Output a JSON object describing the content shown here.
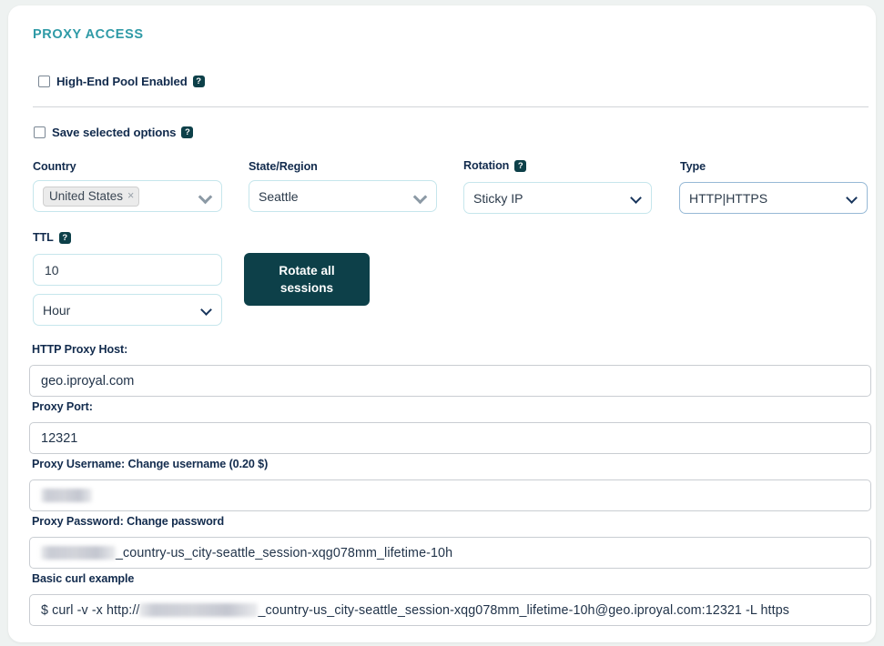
{
  "section": {
    "title": "PROXY ACCESS"
  },
  "toggles": {
    "high_end_pool": {
      "label": "High-End Pool Enabled",
      "checked": false,
      "help": "?"
    },
    "save_options": {
      "label": "Save selected options",
      "checked": false,
      "help": "?"
    }
  },
  "filters": {
    "country": {
      "label": "Country",
      "chip_value": "United States",
      "chip_remove": "×"
    },
    "state_region": {
      "label": "State/Region",
      "value": "Seattle"
    },
    "rotation": {
      "label": "Rotation",
      "help": "?",
      "value": "Sticky IP"
    },
    "type": {
      "label": "Type",
      "value": "HTTP|HTTPS"
    },
    "ttl": {
      "label": "TTL",
      "help": "?",
      "value": "10",
      "unit": "Hour"
    }
  },
  "actions": {
    "rotate_all_sessions": "Rotate all sessions"
  },
  "credentials": {
    "http_proxy_host": {
      "label": "HTTP Proxy Host:",
      "value": "geo.iproyal.com"
    },
    "proxy_port": {
      "label": "Proxy Port:",
      "value": "12321"
    },
    "proxy_username": {
      "label": "Proxy Username: Change username (0.20 $)",
      "value_masked": true,
      "value_suffix": ""
    },
    "proxy_password": {
      "label": "Proxy Password: Change password",
      "value_masked": true,
      "value_suffix": "_country-us_city-seattle_session-xqg078mm_lifetime-10h"
    },
    "curl_example": {
      "label": "Basic curl example",
      "prefix": "$ curl -v -x http://",
      "value_masked": true,
      "value_suffix": "_country-us_city-seattle_session-xqg078mm_lifetime-10h@geo.iproyal.com:12321 -L https"
    }
  },
  "colors": {
    "accent_title": "#2e9aa6",
    "button_dark": "#0d4049",
    "label_text": "#122b4d",
    "input_border": "#c9cdd2",
    "select_border": "#c6e6ec",
    "page_background": "#eef2f1"
  }
}
